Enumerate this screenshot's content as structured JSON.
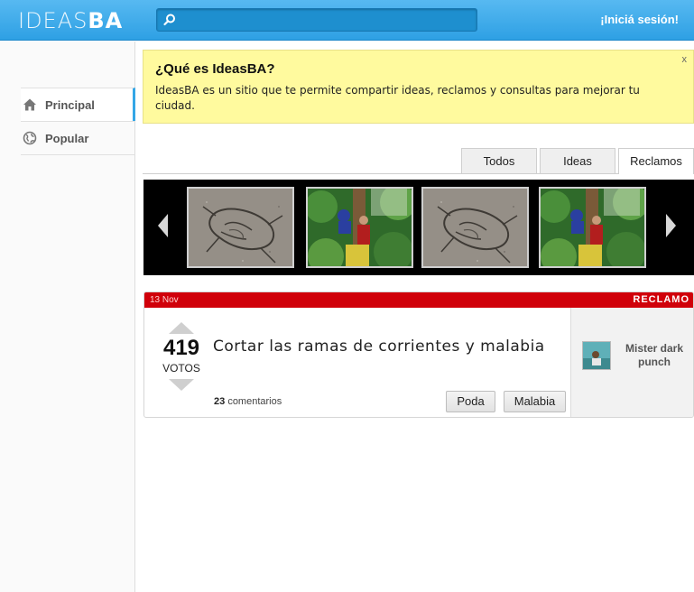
{
  "header": {
    "logo_light": "IDEAS",
    "logo_bold": "BA",
    "search": {
      "placeholder": "",
      "value": ""
    },
    "login_label": "¡Iniciá sesión!"
  },
  "sidebar": {
    "items": [
      {
        "label": "Principal",
        "icon": "home-icon",
        "active": true
      },
      {
        "label": "Popular",
        "icon": "globe-icon",
        "active": false
      }
    ]
  },
  "info_box": {
    "title": "¿Qué es IdeasBA?",
    "text": "IdeasBA es un sitio que te permite compartir ideas, reclamos y consultas para mejorar tu ciudad.",
    "close_label": "x"
  },
  "tabs": [
    {
      "label": "Todos",
      "active": false
    },
    {
      "label": "Ideas",
      "active": false
    },
    {
      "label": "Reclamos",
      "active": true
    }
  ],
  "carousel": {
    "thumbnails": [
      "pothole-photo",
      "tree-pruning-photo",
      "pothole-photo",
      "tree-pruning-photo"
    ]
  },
  "post": {
    "date": "13 Nov",
    "type": "RECLAMO",
    "votes": "419",
    "votes_label": "VOTOS",
    "title": "Cortar las ramas de corrientes y malabia",
    "comments_count": "23",
    "comments_label": "comentarios",
    "tags": [
      "Poda",
      "Malabia"
    ],
    "author": "Mister dark punch"
  },
  "colors": {
    "header_blue": "#2ea0e4",
    "accent_blue": "#34a6e6",
    "info_yellow": "#fffa9e",
    "reclamo_red": "#d0000a"
  }
}
